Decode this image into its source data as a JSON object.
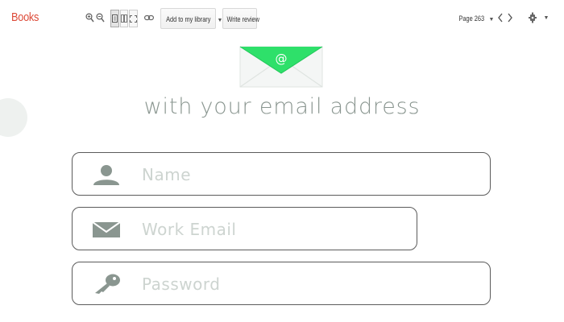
{
  "toolbar": {
    "brand": "Books",
    "zoom_in_icon": "zoom-in-icon",
    "zoom_out_icon": "zoom-out-icon",
    "link_icon": "link-icon",
    "add_library_label": "Add to my library",
    "write_review_label": "Write review",
    "page_label": "Page 263",
    "prev_icon": "chevron-left-icon",
    "next_icon": "chevron-right-icon",
    "settings_icon": "gear-icon"
  },
  "content": {
    "headline": "with your email address",
    "envelope_symbol": "@",
    "accent_color": "#2ee06a",
    "fields": [
      {
        "icon": "user-icon",
        "placeholder": "Name"
      },
      {
        "icon": "mail-icon",
        "placeholder": "Work Email"
      },
      {
        "icon": "key-icon",
        "placeholder": "Password"
      }
    ]
  }
}
